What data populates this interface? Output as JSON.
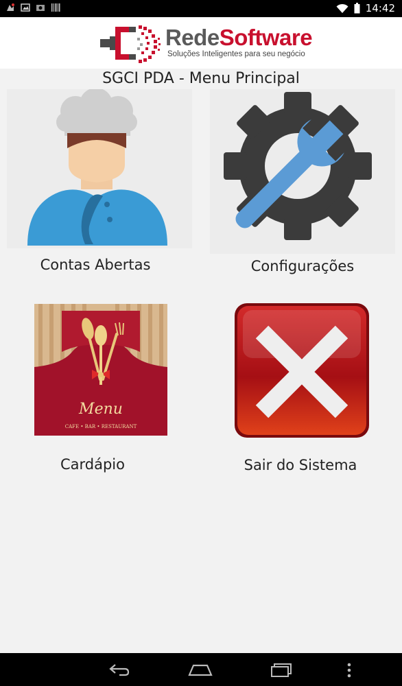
{
  "status_bar": {
    "time": "14:42"
  },
  "header": {
    "brand_part1": "Rede",
    "brand_part2": "Software",
    "tagline": "Soluções Inteligentes para seu negócio"
  },
  "page_title": "SGCI PDA - Menu Principal",
  "menu": {
    "contas_label": "Contas Abertas",
    "config_label": "Configurações",
    "cardapio_label": "Cardápio",
    "cardapio_menu_word": "Menu",
    "cardapio_subtext": "CAFE • BAR • RESTAURANT",
    "sair_label": "Sair do Sistema"
  },
  "colors": {
    "brand_red": "#c8102e",
    "brand_gray": "#5a5a5a",
    "chef_shirt": "#3a9bd5",
    "gear": "#3b3b3b",
    "wrench": "#5b9bd5",
    "exit_red": "#c0141b"
  },
  "icons": [
    "wifi-icon",
    "battery-icon",
    "back-icon",
    "home-icon",
    "recents-icon",
    "overflow-menu-icon",
    "chef-icon",
    "gear-wrench-icon",
    "menu-card-icon",
    "exit-x-icon"
  ]
}
